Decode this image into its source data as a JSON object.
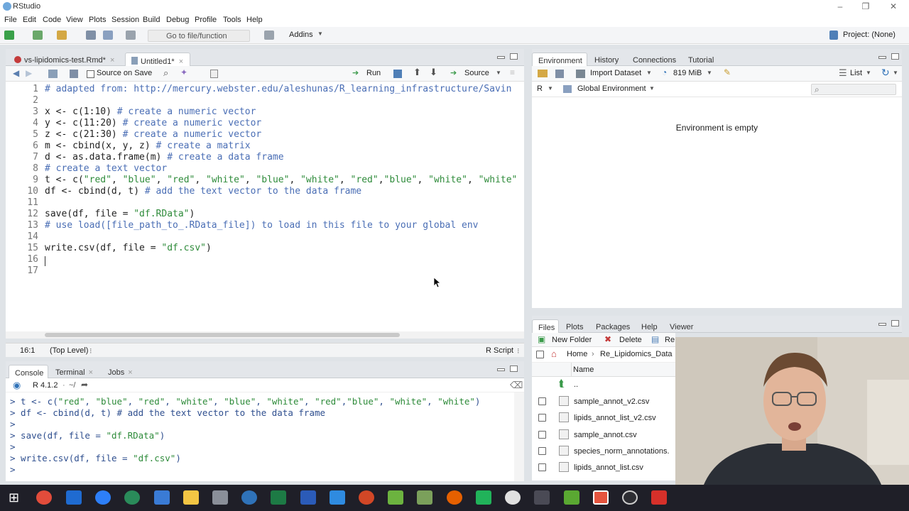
{
  "window": {
    "title": "RStudio"
  },
  "menu": [
    "File",
    "Edit",
    "Code",
    "View",
    "Plots",
    "Session",
    "Build",
    "Debug",
    "Profile",
    "Tools",
    "Help"
  ],
  "toolbar": {
    "goto_placeholder": "Go to file/function",
    "addins_label": "Addins",
    "project_label": "Project: (None)"
  },
  "source": {
    "tabs": [
      {
        "label": "vs-lipidomics-test.Rmd*",
        "active": false
      },
      {
        "label": "Untitled1*",
        "active": true
      }
    ],
    "source_on_save_label": "Source on Save",
    "run_label": "Run",
    "source_label": "Source",
    "code_lines": [
      {
        "n": "1",
        "parts": [
          {
            "t": "# adapted from: http://mercury.webster.edu/aleshunas/R_learning_infrastructure/Savin",
            "c": "cm"
          }
        ]
      },
      {
        "n": "2",
        "parts": []
      },
      {
        "n": "3",
        "parts": [
          {
            "t": "x <- c(1:10) ",
            "c": "paren"
          },
          {
            "t": "# create a numeric vector",
            "c": "cm"
          }
        ]
      },
      {
        "n": "4",
        "parts": [
          {
            "t": "y <- c(11:20) ",
            "c": "paren"
          },
          {
            "t": "# create a numeric vector",
            "c": "cm"
          }
        ]
      },
      {
        "n": "5",
        "parts": [
          {
            "t": "z <- c(21:30) ",
            "c": "paren"
          },
          {
            "t": "# create a numeric vector",
            "c": "cm"
          }
        ]
      },
      {
        "n": "6",
        "parts": [
          {
            "t": "m <- cbind(x, y, z) ",
            "c": "paren"
          },
          {
            "t": "# create a matrix",
            "c": "cm"
          }
        ]
      },
      {
        "n": "7",
        "parts": [
          {
            "t": "d <- as.data.frame(m) ",
            "c": "paren"
          },
          {
            "t": "# create a data frame",
            "c": "cm"
          }
        ]
      },
      {
        "n": "8",
        "parts": [
          {
            "t": "# create a text vector",
            "c": "cm"
          }
        ]
      },
      {
        "n": "9",
        "parts": [
          {
            "t": "t <- c(",
            "c": "paren"
          },
          {
            "t": "\"red\"",
            "c": "str"
          },
          {
            "t": ", ",
            "c": "paren"
          },
          {
            "t": "\"blue\"",
            "c": "str"
          },
          {
            "t": ", ",
            "c": "paren"
          },
          {
            "t": "\"red\"",
            "c": "str"
          },
          {
            "t": ", ",
            "c": "paren"
          },
          {
            "t": "\"white\"",
            "c": "str"
          },
          {
            "t": ", ",
            "c": "paren"
          },
          {
            "t": "\"blue\"",
            "c": "str"
          },
          {
            "t": ", ",
            "c": "paren"
          },
          {
            "t": "\"white\"",
            "c": "str"
          },
          {
            "t": ", ",
            "c": "paren"
          },
          {
            "t": "\"red\"",
            "c": "str"
          },
          {
            "t": ",",
            "c": "paren"
          },
          {
            "t": "\"blue\"",
            "c": "str"
          },
          {
            "t": ", ",
            "c": "paren"
          },
          {
            "t": "\"white\"",
            "c": "str"
          },
          {
            "t": ", ",
            "c": "paren"
          },
          {
            "t": "\"white\"",
            "c": "str"
          }
        ]
      },
      {
        "n": "10",
        "parts": [
          {
            "t": "df <- cbind(d, t) ",
            "c": "paren"
          },
          {
            "t": "# add the text vector to the data frame",
            "c": "cm"
          }
        ]
      },
      {
        "n": "11",
        "parts": []
      },
      {
        "n": "12",
        "parts": [
          {
            "t": "save(df, file = ",
            "c": "paren"
          },
          {
            "t": "\"df.RData\"",
            "c": "str"
          },
          {
            "t": ")",
            "c": "paren"
          }
        ]
      },
      {
        "n": "13",
        "parts": [
          {
            "t": "# use load([file_path_to_.RData_file]) to load in this file to your global env",
            "c": "cm"
          }
        ]
      },
      {
        "n": "14",
        "parts": []
      },
      {
        "n": "15",
        "parts": [
          {
            "t": "write.csv(df, file = ",
            "c": "paren"
          },
          {
            "t": "\"df.csv\"",
            "c": "str"
          },
          {
            "t": ")",
            "c": "paren"
          }
        ]
      },
      {
        "n": "16",
        "parts": []
      },
      {
        "n": "17",
        "parts": []
      }
    ],
    "status_pos": "16:1",
    "status_scope": "(Top Level)",
    "status_type": "R Script"
  },
  "console": {
    "tabs": [
      "Console",
      "Terminal",
      "Jobs"
    ],
    "r_version": "R 4.1.2",
    "path": "~/",
    "lines": [
      {
        "parts": [
          {
            "t": "> t <- c(",
            "c": "cmd"
          },
          {
            "t": "\"red\"",
            "c": "str"
          },
          {
            "t": ", ",
            "c": "cmd"
          },
          {
            "t": "\"blue\"",
            "c": "str"
          },
          {
            "t": ", ",
            "c": "cmd"
          },
          {
            "t": "\"red\"",
            "c": "str"
          },
          {
            "t": ", ",
            "c": "cmd"
          },
          {
            "t": "\"white\"",
            "c": "str"
          },
          {
            "t": ", ",
            "c": "cmd"
          },
          {
            "t": "\"blue\"",
            "c": "str"
          },
          {
            "t": ", ",
            "c": "cmd"
          },
          {
            "t": "\"white\"",
            "c": "str"
          },
          {
            "t": ", ",
            "c": "cmd"
          },
          {
            "t": "\"red\"",
            "c": "str"
          },
          {
            "t": ",",
            "c": "cmd"
          },
          {
            "t": "\"blue\"",
            "c": "str"
          },
          {
            "t": ", ",
            "c": "cmd"
          },
          {
            "t": "\"white\"",
            "c": "str"
          },
          {
            "t": ", ",
            "c": "cmd"
          },
          {
            "t": "\"white\"",
            "c": "str"
          },
          {
            "t": ")",
            "c": "cmd"
          }
        ]
      },
      {
        "parts": [
          {
            "t": "> df <- cbind(d, t) ",
            "c": "cmd"
          },
          {
            "t": "# add the text vector to the data frame",
            "c": "cmd"
          }
        ]
      },
      {
        "parts": [
          {
            "t": ">",
            "c": "cmd"
          }
        ]
      },
      {
        "parts": [
          {
            "t": "> save(df, file = ",
            "c": "cmd"
          },
          {
            "t": "\"df.RData\"",
            "c": "str"
          },
          {
            "t": ")",
            "c": "cmd"
          }
        ]
      },
      {
        "parts": [
          {
            "t": ">",
            "c": "cmd"
          }
        ]
      },
      {
        "parts": [
          {
            "t": "> write.csv(df, file = ",
            "c": "cmd"
          },
          {
            "t": "\"df.csv\"",
            "c": "str"
          },
          {
            "t": ")",
            "c": "cmd"
          }
        ]
      },
      {
        "parts": [
          {
            "t": "> ",
            "c": "cmd"
          }
        ]
      }
    ]
  },
  "environment": {
    "tabs": [
      "Environment",
      "History",
      "Connections",
      "Tutorial"
    ],
    "import_dataset_label": "Import Dataset",
    "memory_label": "819 MiB",
    "list_label": "List",
    "r_label": "R",
    "scope_label": "Global Environment",
    "empty_message": "Environment is empty"
  },
  "files": {
    "tabs": [
      "Files",
      "Plots",
      "Packages",
      "Help",
      "Viewer"
    ],
    "new_folder_label": "New Folder",
    "delete_label": "Delete",
    "rename_label": "Re",
    "breadcrumb": [
      "Home",
      "Re_Lipidomics_Data"
    ],
    "name_header": "Name",
    "up_label": "..",
    "rows": [
      "sample_annot_v2.csv",
      "lipids_annot_list_v2.csv",
      "sample_annot.csv",
      "species_norm_annotations.",
      "lipids_annot_list.csv"
    ]
  },
  "colors": {
    "comment": "#4a6eb5",
    "string": "#2e8b3a",
    "accent": "#2f72b8"
  }
}
